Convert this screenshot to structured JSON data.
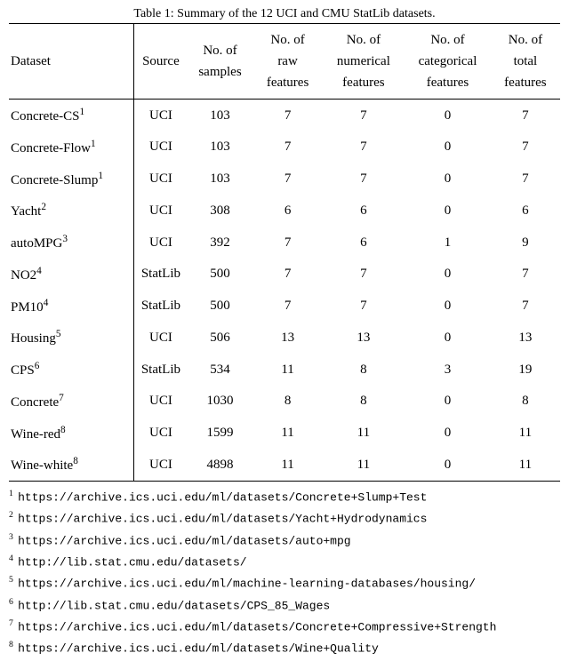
{
  "caption": "Table 1: Summary of the 12 UCI and CMU StatLib datasets.",
  "headers": {
    "dataset": "Dataset",
    "source": "Source",
    "samples_l1": "No. of",
    "samples_l2": "samples",
    "raw_l1": "No. of",
    "raw_l2": "raw",
    "raw_l3": "features",
    "num_l1": "No. of",
    "num_l2": "numerical",
    "num_l3": "features",
    "cat_l1": "No. of",
    "cat_l2": "categorical",
    "cat_l3": "features",
    "total_l1": "No. of",
    "total_l2": "total",
    "total_l3": "features"
  },
  "rows": [
    {
      "name": "Concrete-CS",
      "fn": "1",
      "source": "UCI",
      "samples": "103",
      "raw": "7",
      "num": "7",
      "cat": "0",
      "total": "7"
    },
    {
      "name": "Concrete-Flow",
      "fn": "1",
      "source": "UCI",
      "samples": "103",
      "raw": "7",
      "num": "7",
      "cat": "0",
      "total": "7"
    },
    {
      "name": "Concrete-Slump",
      "fn": "1",
      "source": "UCI",
      "samples": "103",
      "raw": "7",
      "num": "7",
      "cat": "0",
      "total": "7"
    },
    {
      "name": "Yacht",
      "fn": "2",
      "source": "UCI",
      "samples": "308",
      "raw": "6",
      "num": "6",
      "cat": "0",
      "total": "6"
    },
    {
      "name": "autoMPG",
      "fn": "3",
      "source": "UCI",
      "samples": "392",
      "raw": "7",
      "num": "6",
      "cat": "1",
      "total": "9"
    },
    {
      "name": "NO2",
      "fn": "4",
      "source": "StatLib",
      "samples": "500",
      "raw": "7",
      "num": "7",
      "cat": "0",
      "total": "7"
    },
    {
      "name": "PM10",
      "fn": "4",
      "source": "StatLib",
      "samples": "500",
      "raw": "7",
      "num": "7",
      "cat": "0",
      "total": "7"
    },
    {
      "name": "Housing",
      "fn": "5",
      "source": "UCI",
      "samples": "506",
      "raw": "13",
      "num": "13",
      "cat": "0",
      "total": "13"
    },
    {
      "name": "CPS",
      "fn": "6",
      "source": "StatLib",
      "samples": "534",
      "raw": "11",
      "num": "8",
      "cat": "3",
      "total": "19"
    },
    {
      "name": "Concrete",
      "fn": "7",
      "source": "UCI",
      "samples": "1030",
      "raw": "8",
      "num": "8",
      "cat": "0",
      "total": "8"
    },
    {
      "name": "Wine-red",
      "fn": "8",
      "source": "UCI",
      "samples": "1599",
      "raw": "11",
      "num": "11",
      "cat": "0",
      "total": "11"
    },
    {
      "name": "Wine-white",
      "fn": "8",
      "source": "UCI",
      "samples": "4898",
      "raw": "11",
      "num": "11",
      "cat": "0",
      "total": "11"
    }
  ],
  "footnotes": [
    {
      "n": "1",
      "url": "https://archive.ics.uci.edu/ml/datasets/Concrete+Slump+Test"
    },
    {
      "n": "2",
      "url": "https://archive.ics.uci.edu/ml/datasets/Yacht+Hydrodynamics"
    },
    {
      "n": "3",
      "url": "https://archive.ics.uci.edu/ml/datasets/auto+mpg"
    },
    {
      "n": "4",
      "url": "http://lib.stat.cmu.edu/datasets/"
    },
    {
      "n": "5",
      "url": "https://archive.ics.uci.edu/ml/machine-learning-databases/housing/"
    },
    {
      "n": "6",
      "url": "http://lib.stat.cmu.edu/datasets/CPS_85_Wages"
    },
    {
      "n": "7",
      "url": "https://archive.ics.uci.edu/ml/datasets/Concrete+Compressive+Strength"
    },
    {
      "n": "8",
      "url": "https://archive.ics.uci.edu/ml/datasets/Wine+Quality"
    }
  ],
  "chart_data": {
    "type": "table",
    "title": "Summary of the 12 UCI and CMU StatLib datasets.",
    "columns": [
      "Dataset",
      "Source",
      "No. of samples",
      "No. of raw features",
      "No. of numerical features",
      "No. of categorical features",
      "No. of total features"
    ],
    "rows": [
      [
        "Concrete-CS",
        "UCI",
        103,
        7,
        7,
        0,
        7
      ],
      [
        "Concrete-Flow",
        "UCI",
        103,
        7,
        7,
        0,
        7
      ],
      [
        "Concrete-Slump",
        "UCI",
        103,
        7,
        7,
        0,
        7
      ],
      [
        "Yacht",
        "UCI",
        308,
        6,
        6,
        0,
        6
      ],
      [
        "autoMPG",
        "UCI",
        392,
        7,
        6,
        1,
        9
      ],
      [
        "NO2",
        "StatLib",
        500,
        7,
        7,
        0,
        7
      ],
      [
        "PM10",
        "StatLib",
        500,
        7,
        7,
        0,
        7
      ],
      [
        "Housing",
        "UCI",
        506,
        13,
        13,
        0,
        13
      ],
      [
        "CPS",
        "StatLib",
        534,
        11,
        8,
        3,
        19
      ],
      [
        "Concrete",
        "UCI",
        1030,
        8,
        8,
        0,
        8
      ],
      [
        "Wine-red",
        "UCI",
        1599,
        11,
        11,
        0,
        11
      ],
      [
        "Wine-white",
        "UCI",
        4898,
        11,
        11,
        0,
        11
      ]
    ]
  }
}
